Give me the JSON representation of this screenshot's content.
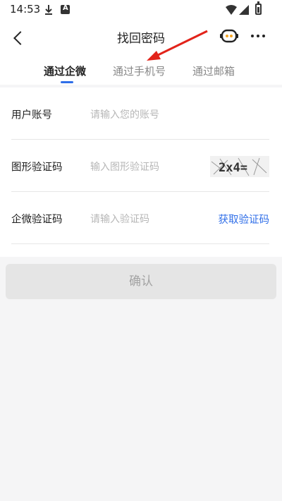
{
  "status_bar": {
    "time": "14:53"
  },
  "header": {
    "title": "找回密码"
  },
  "tabs": [
    {
      "label": "通过企微",
      "active": true
    },
    {
      "label": "通过手机号",
      "active": false
    },
    {
      "label": "通过邮箱",
      "active": false
    }
  ],
  "form": {
    "username": {
      "label": "用户账号",
      "placeholder": "请输入您的账号"
    },
    "captcha": {
      "label": "图形验证码",
      "placeholder": "输入图形验证码",
      "image_text": "2x4="
    },
    "wecom_code": {
      "label": "企微验证码",
      "placeholder": "请输入验证码",
      "action": "获取验证码"
    }
  },
  "confirm_label": "确认",
  "colors": {
    "accent": "#2f6ee8",
    "arrow": "#e2231a",
    "disabled_button": "#e5e5e5"
  }
}
